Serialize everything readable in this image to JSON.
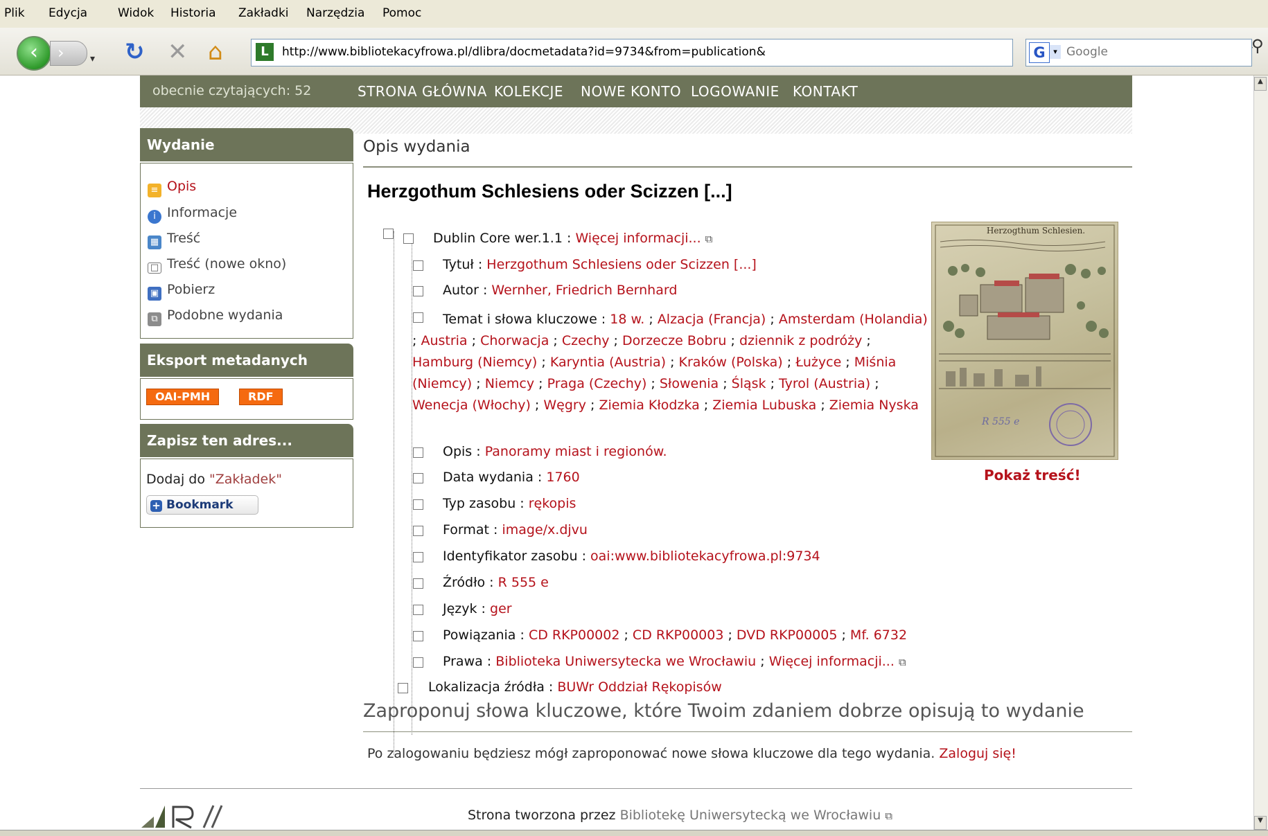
{
  "browser": {
    "menu": [
      "Plik",
      "Edycja",
      "Widok",
      "Historia",
      "Zakładki",
      "Narzędzia",
      "Pomoc"
    ],
    "url": "http://www.bibliotekacyfrowa.pl/dlibra/docmetadata?id=9734&from=publication&",
    "search_placeholder": "Google",
    "icons": {
      "back": "back-arrow-icon",
      "forward": "forward-arrow-icon",
      "reload": "reload-icon",
      "stop": "stop-icon",
      "home": "home-icon",
      "rss": "rss-icon",
      "star": "bookmark-star-icon",
      "search_engine": "google-icon",
      "search_go": "magnifier-icon"
    }
  },
  "topbar": {
    "reading": "obecnie czytających: 52",
    "nav": [
      "STRONA GŁÓWNA",
      "KOLEKCJE",
      "NOWE KONTO",
      "LOGOWANIE",
      "KONTAKT"
    ]
  },
  "sidebar": {
    "edition": {
      "title": "Wydanie",
      "items": [
        "Opis",
        "Informacje",
        "Treść",
        "Treść (nowe okno)",
        "Pobierz",
        "Podobne wydania"
      ]
    },
    "export": {
      "title": "Eksport metadanych",
      "buttons": [
        "OAI-PMH",
        "RDF"
      ]
    },
    "save": {
      "title": "Zapisz ten adres...",
      "text_prefix": "Dodaj do",
      "link": "\"Zakładek\"",
      "bookmark": "Bookmark"
    }
  },
  "main": {
    "section_title": "Opis wydania",
    "pub_title": "Herzgothum Schlesiens oder Scizzen [...]",
    "dublin": {
      "label": "Dublin Core wer.1.1 :",
      "more": "Więcej informacji..."
    },
    "fields": {
      "title": {
        "label": "Tytuł :",
        "value": "Herzgothum Schlesiens oder Scizzen [...]"
      },
      "author": {
        "label": "Autor :",
        "value": "Wernher, Friedrich Bernhard"
      },
      "subject": {
        "label": "Temat i słowa kluczowe :",
        "values": [
          "18 w.",
          "Alzacja (Francja)",
          "Amsterdam (Holandia)",
          "Austria",
          "Chorwacja",
          "Czechy",
          "Dorzecze Bobru",
          "dziennik z podróży",
          "Hamburg (Niemcy)",
          "Karyntia (Austria)",
          "Kraków (Polska)",
          "Łużyce",
          "Miśnia (Niemcy)",
          "Niemcy",
          "Praga (Czechy)",
          "Słowenia",
          "Śląsk",
          "Tyrol (Austria)",
          "Wenecja (Włochy)",
          "Węgry",
          "Ziemia Kłodzka",
          "Ziemia Lubuska",
          "Ziemia Nyska"
        ]
      },
      "description": {
        "label": "Opis :",
        "value": "Panoramy miast i regionów."
      },
      "date": {
        "label": "Data wydania :",
        "value": "1760"
      },
      "type": {
        "label": "Typ zasobu :",
        "value": "rękopis"
      },
      "format": {
        "label": "Format :",
        "value": "image/x.djvu"
      },
      "identifier": {
        "label": "Identyfikator zasobu :",
        "value": "oai:www.bibliotekacyfrowa.pl:9734"
      },
      "source": {
        "label": "Źródło :",
        "value": "R 555 e"
      },
      "language": {
        "label": "Język :",
        "value": "ger"
      },
      "relation": {
        "label": "Powiązania :",
        "values": [
          "CD RKP00002",
          "CD RKP00003",
          "DVD RKP00005",
          "Mf. 6732"
        ]
      },
      "rights": {
        "label": "Prawa :",
        "value": "Biblioteka Uniwersytecka we Wrocławiu",
        "more": "Więcej informacji..."
      },
      "location": {
        "label": "Lokalizacja źródła :",
        "value": "BUWr Oddział Rękopisów"
      }
    },
    "thumbnail": {
      "heading": "Herzogthum Schlesien.",
      "signature": "R 555 e"
    },
    "show_content": "Pokaż treść!",
    "propose_title": "Zaproponuj słowa kluczowe, które Twoim zdaniem dobrze opisują to wydanie",
    "login_text": "Po zalogowaniu będziesz mógł zaproponować nowe słowa kluczowe dla tego wydania.",
    "login_link": "Zaloguj się!"
  },
  "footer": {
    "text": "Strona tworzona przez",
    "link": "Bibliotekę Uniwersytecką we Wrocławiu"
  }
}
